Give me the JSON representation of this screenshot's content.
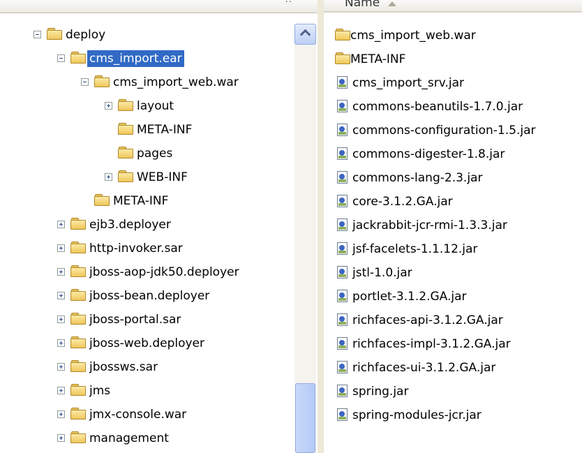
{
  "tree": {
    "items": [
      {
        "label": "deploy",
        "level": 0,
        "toggle": "minus",
        "selected": false
      },
      {
        "label": "cms_import.ear",
        "level": 1,
        "toggle": "minus",
        "selected": true
      },
      {
        "label": "cms_import_web.war",
        "level": 2,
        "toggle": "minus",
        "selected": false
      },
      {
        "label": "layout",
        "level": 3,
        "toggle": "plus",
        "selected": false
      },
      {
        "label": "META-INF",
        "level": 3,
        "toggle": "none",
        "selected": false
      },
      {
        "label": "pages",
        "level": 3,
        "toggle": "none",
        "selected": false
      },
      {
        "label": "WEB-INF",
        "level": 3,
        "toggle": "plus",
        "selected": false
      },
      {
        "label": "META-INF",
        "level": 2,
        "toggle": "none",
        "selected": false
      },
      {
        "label": "ejb3.deployer",
        "level": 1,
        "toggle": "plus",
        "selected": false
      },
      {
        "label": "http-invoker.sar",
        "level": 1,
        "toggle": "plus",
        "selected": false
      },
      {
        "label": "jboss-aop-jdk50.deployer",
        "level": 1,
        "toggle": "plus",
        "selected": false
      },
      {
        "label": "jboss-bean.deployer",
        "level": 1,
        "toggle": "plus",
        "selected": false
      },
      {
        "label": "jboss-portal.sar",
        "level": 1,
        "toggle": "plus",
        "selected": false
      },
      {
        "label": "jboss-web.deployer",
        "level": 1,
        "toggle": "plus",
        "selected": false
      },
      {
        "label": "jbossws.sar",
        "level": 1,
        "toggle": "plus",
        "selected": false
      },
      {
        "label": "jms",
        "level": 1,
        "toggle": "plus",
        "selected": false
      },
      {
        "label": "jmx-console.war",
        "level": 1,
        "toggle": "plus",
        "selected": false
      },
      {
        "label": "management",
        "level": 1,
        "toggle": "plus",
        "selected": false
      }
    ]
  },
  "list": {
    "column_name": "Name",
    "items": [
      {
        "name": "cms_import_web.war",
        "type": "folder"
      },
      {
        "name": "META-INF",
        "type": "folder"
      },
      {
        "name": "cms_import_srv.jar",
        "type": "jar"
      },
      {
        "name": "commons-beanutils-1.7.0.jar",
        "type": "jar"
      },
      {
        "name": "commons-configuration-1.5.jar",
        "type": "jar"
      },
      {
        "name": "commons-digester-1.8.jar",
        "type": "jar"
      },
      {
        "name": "commons-lang-2.3.jar",
        "type": "jar"
      },
      {
        "name": "core-3.1.2.GA.jar",
        "type": "jar"
      },
      {
        "name": "jackrabbit-jcr-rmi-1.3.3.jar",
        "type": "jar"
      },
      {
        "name": "jsf-facelets-1.1.12.jar",
        "type": "jar"
      },
      {
        "name": "jstl-1.0.jar",
        "type": "jar"
      },
      {
        "name": "portlet-3.1.2.GA.jar",
        "type": "jar"
      },
      {
        "name": "richfaces-api-3.1.2.GA.jar",
        "type": "jar"
      },
      {
        "name": "richfaces-impl-3.1.2.GA.jar",
        "type": "jar"
      },
      {
        "name": "richfaces-ui-3.1.2.GA.jar",
        "type": "jar"
      },
      {
        "name": "spring.jar",
        "type": "jar"
      },
      {
        "name": "spring-modules-jcr.jar",
        "type": "jar"
      }
    ]
  },
  "colors": {
    "selection": "#316ac5",
    "folder": "#f0c75a"
  },
  "icons": {
    "folder": "folder-icon",
    "jar": "jar-file-icon",
    "expand": "plus-icon",
    "collapse": "minus-icon"
  }
}
